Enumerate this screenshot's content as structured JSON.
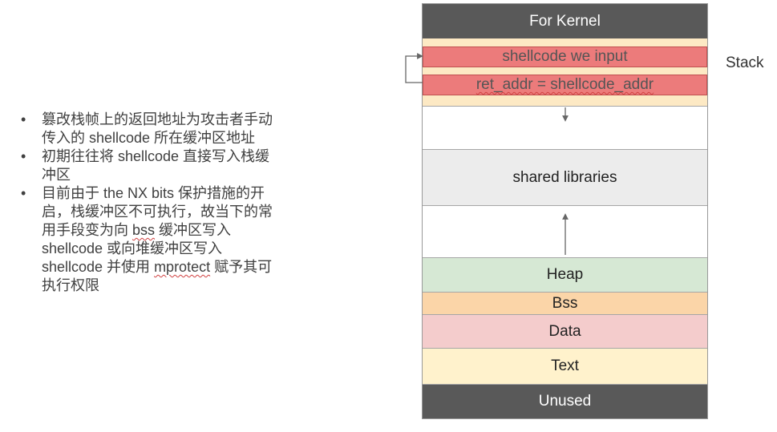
{
  "bullets": [
    {
      "before": "篡改栈帧上的返回地址为攻击者手动传入的 shellcode 所在缓冲区地址",
      "marked": "",
      "after": ""
    },
    {
      "before": "初期往往将 shellcode 直接写入栈缓冲区",
      "marked": "",
      "after": ""
    },
    {
      "before": "目前由于 the NX bits 保护措施的开启，栈缓冲区不可执行，故当下的常用手段变为向 ",
      "marked": "bss",
      "after": " 缓冲区写入 shellcode 或向堆缓冲区写入 shellcode 并使用 "
    },
    {
      "before": "",
      "marked": "mprotect",
      "after": " 赋予其可执行权限"
    }
  ],
  "memory": {
    "kernel": "For Kernel",
    "shellcode": "shellcode we input",
    "ret_addr": "ret_addr = shellcode_addr",
    "shared_libraries": "shared libraries",
    "heap": "Heap",
    "bss": "Bss",
    "data": "Data",
    "text": "Text",
    "unused": "Unused"
  },
  "stack_label": "Stack",
  "icons": [
    "down-arrow-icon",
    "up-arrow-icon",
    "loop-arrow-icon"
  ],
  "colors": {
    "dark": "#595959",
    "red": "#ec7b7b",
    "cream": "#fde9c4",
    "gray": "#ececec",
    "green": "#d6e8d4",
    "orange": "#fbd5a8",
    "pink": "#f4cccc",
    "yellow": "#fff2cc"
  }
}
